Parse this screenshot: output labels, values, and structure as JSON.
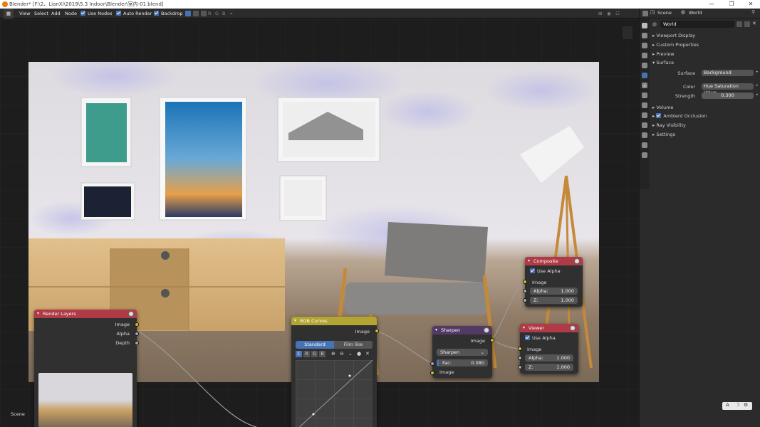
{
  "window": {
    "title": "Blender* [F:\\2、LianXi\\2019\\5.3 Indoor\\Blender\\室内-01.blend]",
    "controls": [
      "—",
      "❐",
      "✕"
    ]
  },
  "menubar": {
    "menus": [
      "View",
      "Select",
      "Add",
      "Node"
    ],
    "use_nodes_label": "Use Nodes",
    "auto_render_label": "Auto Render",
    "backdrop_label": "Backdrop",
    "channels": [
      "C",
      "R",
      "G",
      "B"
    ]
  },
  "nodes": {
    "render_layers": {
      "title": "Render Layers",
      "outputs": [
        "Image",
        "Alpha",
        "Depth"
      ],
      "footer": "Scene"
    },
    "rgb_curves": {
      "title": "RGB Curves",
      "output": "Image",
      "tab_standard": "Standard",
      "tab_film": "Film like",
      "channels": [
        "C",
        "R",
        "G",
        "B"
      ]
    },
    "sharpen": {
      "title": "Sharpen",
      "output": "Image",
      "mode": "Sharpen",
      "fac_label": "Fac:",
      "fac_value": "0.080",
      "input": "Image"
    },
    "composite": {
      "title": "Composite",
      "use_alpha": "Use Alpha",
      "input": "Image",
      "alpha_label": "Alpha:",
      "alpha_value": "1.000",
      "z_label": "Z:",
      "z_value": "1.000"
    },
    "viewer": {
      "title": "Viewer",
      "use_alpha": "Use Alpha",
      "input": "Image",
      "alpha_label": "Alpha:",
      "alpha_value": "1.000",
      "z_label": "Z:",
      "z_value": "1.000"
    }
  },
  "properties": {
    "header_scene": "Scene",
    "header_world": "World",
    "world_name": "World",
    "panels": {
      "viewport_display": "Viewport Display",
      "custom_properties": "Custom Properties",
      "preview": "Preview",
      "surface": "Surface",
      "volume": "Volume",
      "ambient_occlusion": "Ambient Occlusion",
      "ray_visibility": "Ray Visibility",
      "settings": "Settings"
    },
    "surface_label": "Surface",
    "surface_value": "Background",
    "color_label": "Color",
    "color_value": "Hue Saturation Value",
    "strength_label": "Strength",
    "strength_value": "0.300"
  },
  "colors": {
    "render_layers_header": "#b03a45",
    "rgb_curves_header": "#b2a532",
    "sharpen_header": "#533a65",
    "composite_header": "#b03a45",
    "viewer_header": "#b03a45",
    "socket_color": "#c7c729",
    "accent": "#4772b3"
  }
}
